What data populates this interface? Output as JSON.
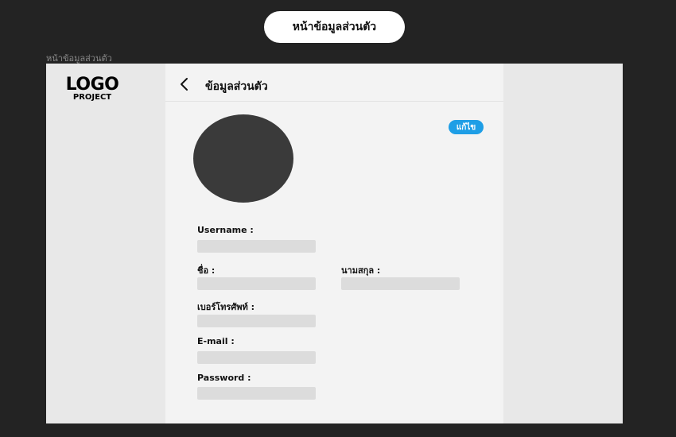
{
  "header": {
    "page_title_pill": "หน้าข้อมูลส่วนตัว"
  },
  "frame": {
    "label": "หน้าข้อมูลส่วนตัว"
  },
  "logo": {
    "main": "LOGO",
    "sub": "PROJECT"
  },
  "content": {
    "back_icon": "chevron-left-icon",
    "title": "ข้อมูลส่วนตัว",
    "edit_label": "แก้ไข",
    "edit_color": "#1e9ee6",
    "avatar_color": "#3a3a3a"
  },
  "form": {
    "username_label": "Username :",
    "username_value": "",
    "firstname_label": "ชื่อ :",
    "firstname_value": "",
    "lastname_label": "นามสกุล :",
    "lastname_value": "",
    "phone_label": "เบอร์โทรศัพท์ :",
    "phone_value": "",
    "email_label": "E-mail :",
    "email_value": "",
    "password_label": "Password :",
    "password_value": ""
  }
}
